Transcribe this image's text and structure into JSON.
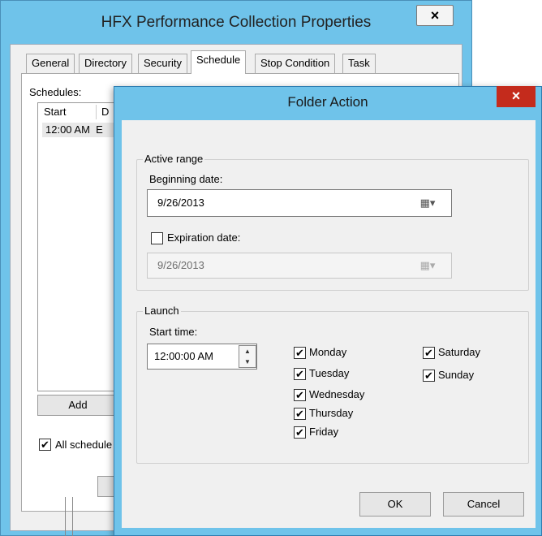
{
  "back_window": {
    "title": "HFX Performance Collection Properties",
    "close_glyph": "×",
    "tabs": [
      "General",
      "Directory",
      "Security",
      "Schedule",
      "Stop Condition",
      "Task"
    ],
    "selected_tab": "Schedule",
    "schedules_label": "Schedules:",
    "columns": [
      "Start",
      "D"
    ],
    "rows": [
      {
        "start": "12:00 AM",
        "d": "E"
      }
    ],
    "add_button": "Add",
    "all_schedules_label": "All schedule",
    "all_schedules_checked": true
  },
  "dialog": {
    "title": "Folder Action",
    "close_glyph": "×",
    "active_range": {
      "legend": "Active range",
      "beginning_label": "Beginning date:",
      "beginning_value": "9/26/2013",
      "expiration_label": "Expiration date:",
      "expiration_checked": false,
      "expiration_value": "9/26/2013",
      "calendar_glyph": "▦▾"
    },
    "launch": {
      "legend": "Launch",
      "start_time_label": "Start time:",
      "start_time_value": "12:00:00 AM",
      "spin_up": "▲",
      "spin_down": "▼",
      "days_col1": [
        {
          "label": "Monday",
          "checked": true
        },
        {
          "label": "Tuesday",
          "checked": true
        },
        {
          "label": "Wednesday",
          "checked": true
        },
        {
          "label": "Thursday",
          "checked": true
        },
        {
          "label": "Friday",
          "checked": true
        }
      ],
      "days_col2": [
        {
          "label": "Saturday",
          "checked": true
        },
        {
          "label": "Sunday",
          "checked": true
        }
      ]
    },
    "ok_button": "OK",
    "cancel_button": "Cancel"
  },
  "check_glyph": "✔",
  "colors": {
    "title_bar": "#6fc3ea",
    "close_active": "#c42b1c",
    "client_bg": "#f0f0f0"
  }
}
